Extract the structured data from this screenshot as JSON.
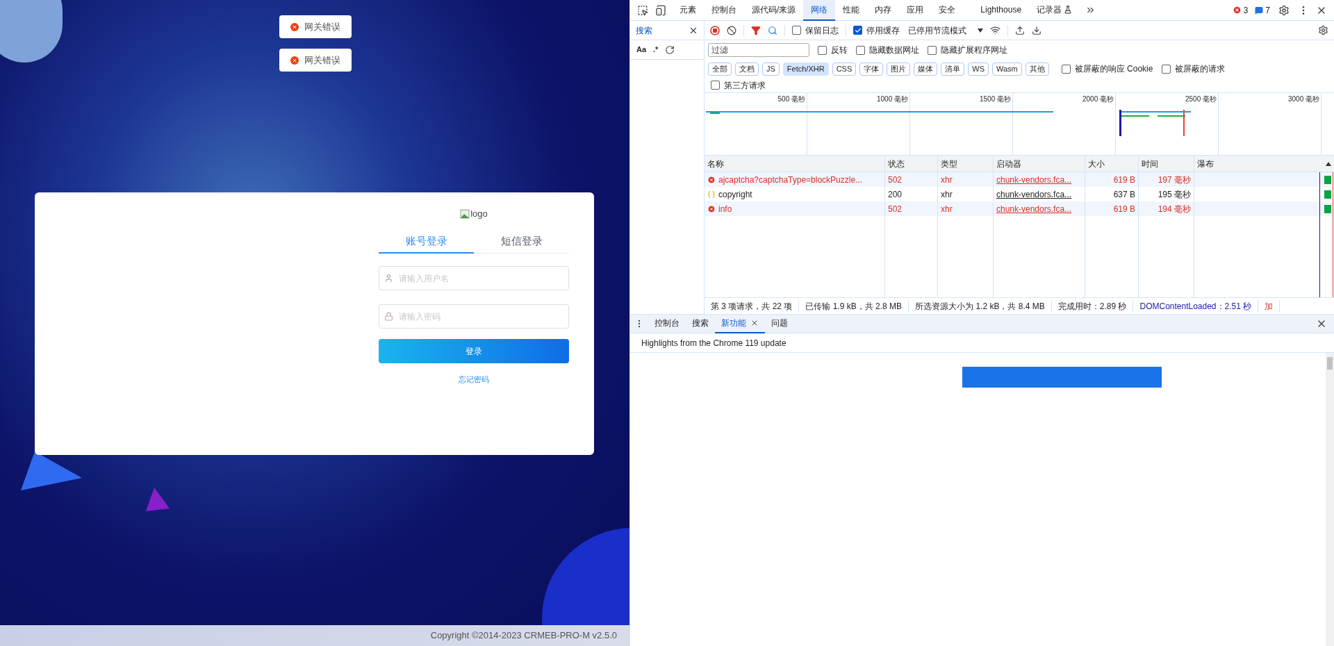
{
  "login_page": {
    "toasts": [
      {
        "text": "网关错误"
      },
      {
        "text": "网关错误"
      }
    ],
    "logo_alt": "logo",
    "tabs": [
      {
        "label": "账号登录",
        "selected": true
      },
      {
        "label": "短信登录",
        "selected": false
      }
    ],
    "fields": [
      {
        "kind": "user",
        "placeholder": "请输入用户名"
      },
      {
        "kind": "lock",
        "placeholder": "请输入密码"
      }
    ],
    "submit": "登录",
    "forgot": "忘记密码",
    "copyright": "Copyright ©2014-2023 CRMEB-PRO-M v2.5.0"
  },
  "devtools": {
    "tabs": [
      {
        "label": "元素",
        "selected": false
      },
      {
        "label": "控制台",
        "selected": false
      },
      {
        "label": "源代码/来源",
        "selected": false
      },
      {
        "label": "网络",
        "selected": true
      },
      {
        "label": "性能",
        "selected": false
      },
      {
        "label": "内存",
        "selected": false
      },
      {
        "label": "应用",
        "selected": false
      },
      {
        "label": "安全",
        "selected": false
      },
      {
        "label": "Lighthouse",
        "selected": false
      },
      {
        "label": "记录器",
        "selected": false
      }
    ],
    "errors": "3",
    "messages": "7",
    "search_panel": {
      "tab": "搜索",
      "case_label": "Aa",
      "regex_label": ".*"
    },
    "network": {
      "preserve_log": {
        "label": "保留日志",
        "checked": false
      },
      "disable_cache": {
        "label": "停用缓存",
        "checked": true
      },
      "throttle": "已停用节流模式",
      "filter": {
        "placeholder": "过滤"
      },
      "filter_checks": [
        {
          "label": "反转",
          "checked": false
        },
        {
          "label": "隐藏数据网址",
          "checked": false
        },
        {
          "label": "隐藏扩展程序网址",
          "checked": false
        }
      ],
      "type_filters": [
        {
          "label": "全部",
          "selected": false
        },
        {
          "label": "文档",
          "selected": false
        },
        {
          "label": "JS",
          "selected": false
        },
        {
          "label": "Fetch/XHR",
          "selected": true
        },
        {
          "label": "CSS",
          "selected": false
        },
        {
          "label": "字体",
          "selected": false
        },
        {
          "label": "图片",
          "selected": false
        },
        {
          "label": "媒体",
          "selected": false
        },
        {
          "label": "清单",
          "selected": false
        },
        {
          "label": "WS",
          "selected": false
        },
        {
          "label": "Wasm",
          "selected": false
        },
        {
          "label": "其他",
          "selected": false
        }
      ],
      "more_checks": [
        {
          "label": "被屏蔽的响应 Cookie",
          "checked": false
        },
        {
          "label": "被屏蔽的请求",
          "checked": false
        }
      ],
      "third_party": {
        "label": "第三方请求",
        "checked": false
      },
      "overview_ticks": [
        "500 毫秒",
        "1000 毫秒",
        "1500 毫秒",
        "2000 毫秒",
        "2500 毫秒",
        "3000 毫秒"
      ],
      "columns": [
        "名称",
        "状态",
        "类型",
        "启动器",
        "大小",
        "时间",
        "瀑布"
      ],
      "rows": [
        {
          "kind": "error",
          "name": "ajcaptcha?captchaType=blockPuzzle...",
          "status": "502",
          "type": "xhr",
          "initiator": "chunk-vendors.fca...",
          "size": "619 B",
          "time": "197 毫秒"
        },
        {
          "kind": "ok",
          "name": "copyright",
          "status": "200",
          "type": "xhr",
          "initiator": "chunk-vendors.fca...",
          "size": "637 B",
          "time": "195 毫秒"
        },
        {
          "kind": "error",
          "name": "info",
          "status": "502",
          "type": "xhr",
          "initiator": "chunk-vendors.fca...",
          "size": "619 B",
          "time": "194 毫秒"
        }
      ],
      "status_bar": [
        {
          "kind": "plain",
          "text": "第 3 项请求，共 22 项"
        },
        {
          "kind": "plain",
          "text": "已传输 1.9 kB，共 2.8 MB"
        },
        {
          "kind": "plain",
          "text": "所选资源大小为 1.2 kB，共 8.4 MB"
        },
        {
          "kind": "plain",
          "text": "完成用时：2.89 秒"
        },
        {
          "kind": "dom",
          "text": "DOMContentLoaded：2.51 秒"
        },
        {
          "kind": "load",
          "text": "加"
        }
      ]
    },
    "drawer": {
      "tabs": [
        {
          "label": "控制台",
          "selected": false,
          "closable": false
        },
        {
          "label": "搜索",
          "selected": false,
          "closable": false
        },
        {
          "label": "新功能",
          "selected": true,
          "closable": true
        },
        {
          "label": "问题",
          "selected": false,
          "closable": false
        }
      ],
      "header": "Highlights from the Chrome 119 update"
    }
  }
}
